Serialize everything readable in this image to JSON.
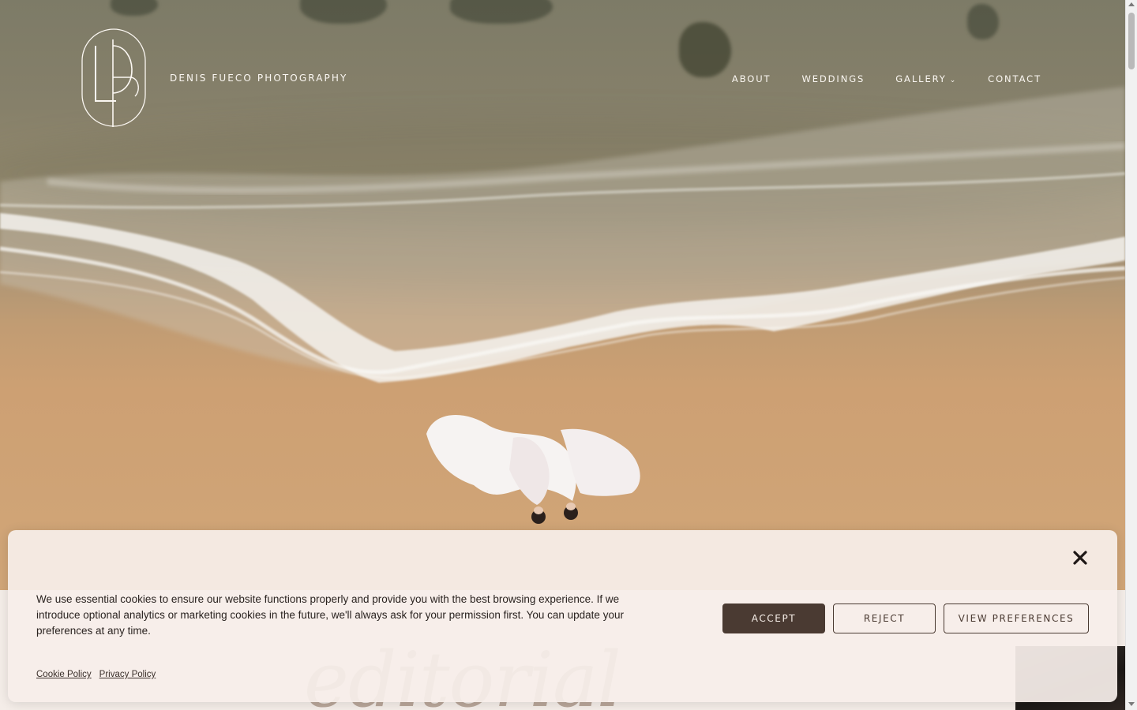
{
  "header": {
    "site_title": "DENIS FUECO PHOTOGRAPHY",
    "logo_icon": "df-monogram-logo"
  },
  "nav": {
    "items": [
      {
        "label": "ABOUT"
      },
      {
        "label": "WEDDINGS"
      },
      {
        "label": "GALLERY",
        "has_dropdown": true
      },
      {
        "label": "CONTACT"
      }
    ]
  },
  "hero": {
    "image_description_icon": "beach-aerial-photo"
  },
  "content": {
    "heading_partial": "editorial"
  },
  "cookie_banner": {
    "text": "We use essential cookies to ensure our website functions properly and provide you with the best browsing experience. If we introduce optional analytics or marketing cookies in the future, we'll always ask for your permission first. You can update your preferences at any time.",
    "accept_label": "ACCEPT",
    "reject_label": "REJECT",
    "preferences_label": "VIEW PREFERENCES",
    "links": [
      {
        "label": "Cookie Policy"
      },
      {
        "label": "Privacy Policy"
      }
    ],
    "close_icon": "close-icon"
  },
  "colors": {
    "accent": "#4a3a32",
    "banner_bg": "#f6eee9",
    "nav_text": "#fbf7f2"
  }
}
